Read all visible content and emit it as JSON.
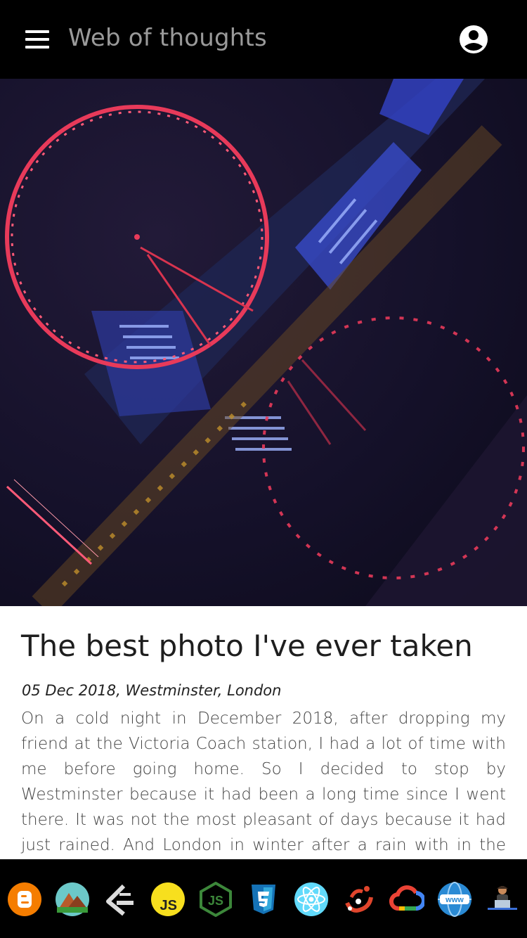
{
  "app": {
    "title": "Web of thoughts",
    "menu_icon": "hamburger-menu-icon",
    "account_icon": "account-circle-icon"
  },
  "article": {
    "title": "The best photo I've ever taken",
    "meta": "05 Dec 2018, Westminster, London",
    "body": "On a cold night in December 2018, after dropping my friend at the Victoria Coach station, I had a lot of time with me before going home. So I decided to stop by Westminster because it had been a long time since I went there. It was not the most pleasant of days because it had just rained. And London in winter after a rain with in the wind is not a"
  },
  "dock": {
    "icons": [
      "blogger-icon",
      "mountains-icon",
      "arrow-logo-icon",
      "javascript-icon",
      "nodejs-icon",
      "css3-icon",
      "react-icon",
      "jupyter-icon",
      "google-cloud-icon",
      "www-icon",
      "developer-avatar-icon"
    ],
    "labels": {
      "js": "JS",
      "www": "www"
    }
  },
  "colors": {
    "background": "#000000",
    "title_gray": "#9a9a9a",
    "card": "#ffffff",
    "blogger": "#f57d00",
    "js_yellow": "#f7df1e",
    "node_green": "#3c873a",
    "css_blue": "#1572b6",
    "react_cyan": "#61dafb"
  }
}
